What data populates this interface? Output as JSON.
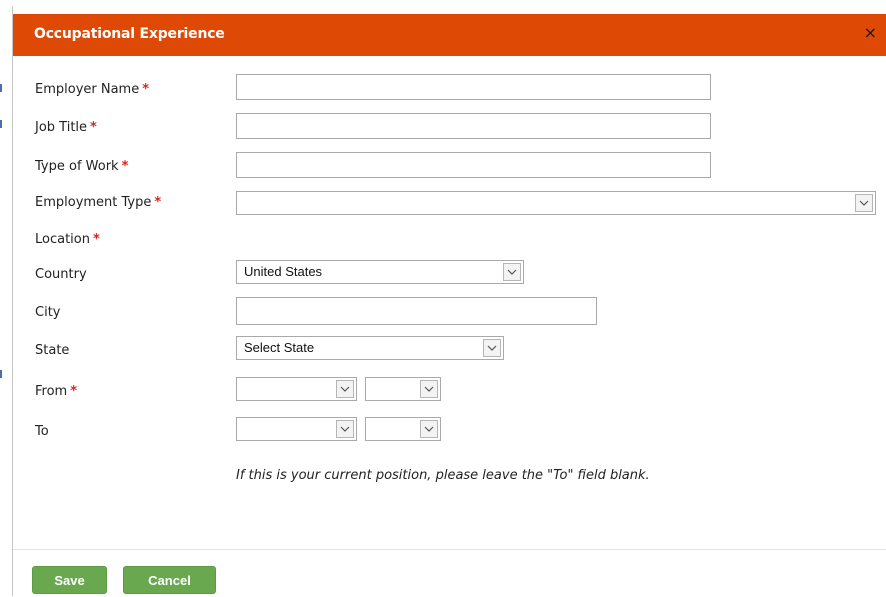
{
  "dialog": {
    "title": "Occupational Experience",
    "close_glyph": "×"
  },
  "form": {
    "required_mark": "*",
    "fields": {
      "employer_name": {
        "label": "Employer Name",
        "value": ""
      },
      "job_title": {
        "label": "Job Title",
        "value": ""
      },
      "type_of_work": {
        "label": "Type of Work",
        "value": ""
      },
      "employment_type": {
        "label": "Employment Type",
        "selected": ""
      },
      "location": {
        "label": "Location"
      },
      "country": {
        "label": "Country",
        "selected": "United States"
      },
      "city": {
        "label": "City",
        "value": ""
      },
      "state": {
        "label": "State",
        "selected": "Select State"
      },
      "from": {
        "label": "From",
        "month": "",
        "year": ""
      },
      "to": {
        "label": "To",
        "month": "",
        "year": ""
      }
    },
    "note": "If this is your current position, please leave the \"To\" field blank."
  },
  "footer": {
    "save_label": "Save",
    "cancel_label": "Cancel"
  },
  "colors": {
    "header_bg": "#de4a05",
    "required": "#e0201a",
    "button_bg": "#6aa84f"
  },
  "icons": {
    "dropdown": "chevron-down-icon",
    "close": "close-icon"
  }
}
